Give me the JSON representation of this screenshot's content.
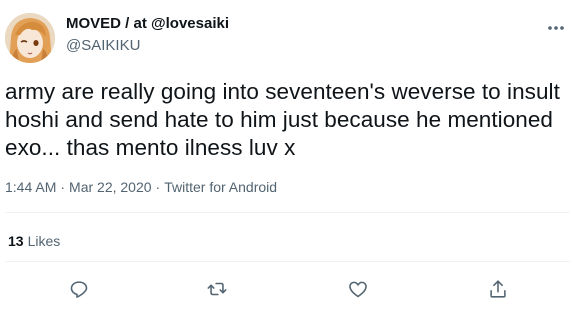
{
  "user": {
    "display_name": "MOVED / at @lovesaiki",
    "handle": "@SAIKIKU",
    "avatar_icon": "anime-avatar"
  },
  "tweet": {
    "lines": [
      "army are really going into seventeen's weverse to insult",
      "hoshi and send hate to him just because he mentioned",
      "exo... thas mento ilness luv x"
    ],
    "time": "1:44 AM",
    "date": "Mar 22, 2020",
    "source": "Twitter for Android",
    "separator": "·"
  },
  "stats": {
    "likes_count": "13",
    "likes_label": "Likes"
  },
  "actions": {
    "reply_icon": "reply-icon",
    "retweet_icon": "retweet-icon",
    "like_icon": "heart-icon",
    "share_icon": "share-icon",
    "more_icon": "more-icon"
  },
  "colors": {
    "text_primary": "#0f1419",
    "text_secondary": "#536471",
    "divider": "#eff3f4"
  }
}
